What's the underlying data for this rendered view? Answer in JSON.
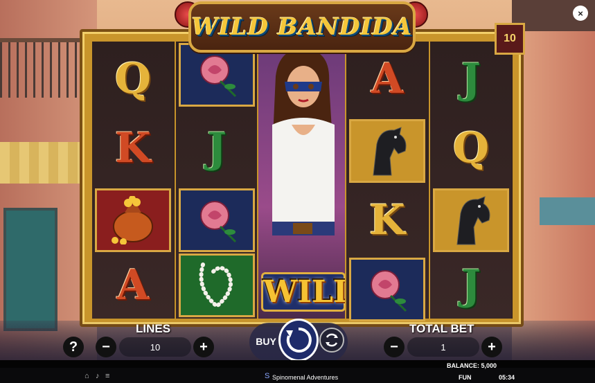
{
  "game": {
    "title": "WILD BANDIDA",
    "lines_badge": "10",
    "close_icon": "×"
  },
  "reels": {
    "reel1": [
      "Q",
      "K",
      "",
      "A"
    ],
    "reel2": [
      "",
      "J",
      "",
      ""
    ],
    "reel3_wild": "WILD",
    "reel4": [
      "A",
      "",
      "K",
      ""
    ],
    "reel5": [
      "J",
      "Q",
      "",
      "J"
    ]
  },
  "controls": {
    "help_label": "?",
    "lines_label": "LINES",
    "lines_value": "10",
    "minus": "−",
    "plus": "+",
    "buy_label": "BUY",
    "total_bet_label": "TOTAL BET",
    "total_bet_value": "1"
  },
  "status": {
    "balance": "BALANCE: 5,000",
    "provider": "Spinomenal Adventures",
    "mode": "FUN",
    "time": "05:34"
  },
  "colors": {
    "frame_gold": "#c9952b",
    "spin_blue": "#1e2b6a"
  }
}
